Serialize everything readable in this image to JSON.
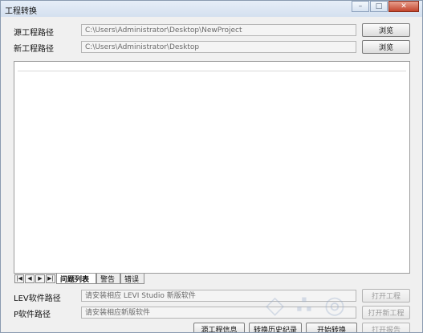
{
  "window": {
    "title": "工程转换",
    "minimize_glyph": "–",
    "restore_glyph": "□",
    "close_glyph": "✕"
  },
  "source": {
    "label": "源工程路径",
    "value": "C:\\Users\\Administrator\\Desktop\\NewProject",
    "browse_label": "浏览"
  },
  "target": {
    "label": "新工程路径",
    "value": "C:\\Users\\Administrator\\Desktop",
    "browse_label": "浏览"
  },
  "tabs": {
    "nav": [
      "|◀",
      "◀",
      "▶",
      "▶|"
    ],
    "items": [
      "问题列表",
      "警告",
      "错误"
    ]
  },
  "lev": {
    "label": "LEV软件路径",
    "placeholder": "请安装相应 LEVI Studio 新版软件",
    "open_label": "打开工程"
  },
  "p_software": {
    "label": "P软件路径",
    "placeholder": "请安装相应新版软件",
    "open_label": "打开新工程"
  },
  "bottom_buttons": {
    "source_info": "源工程信息",
    "history": "转换历史纪录",
    "start": "开始转换",
    "report": "打开报告"
  }
}
